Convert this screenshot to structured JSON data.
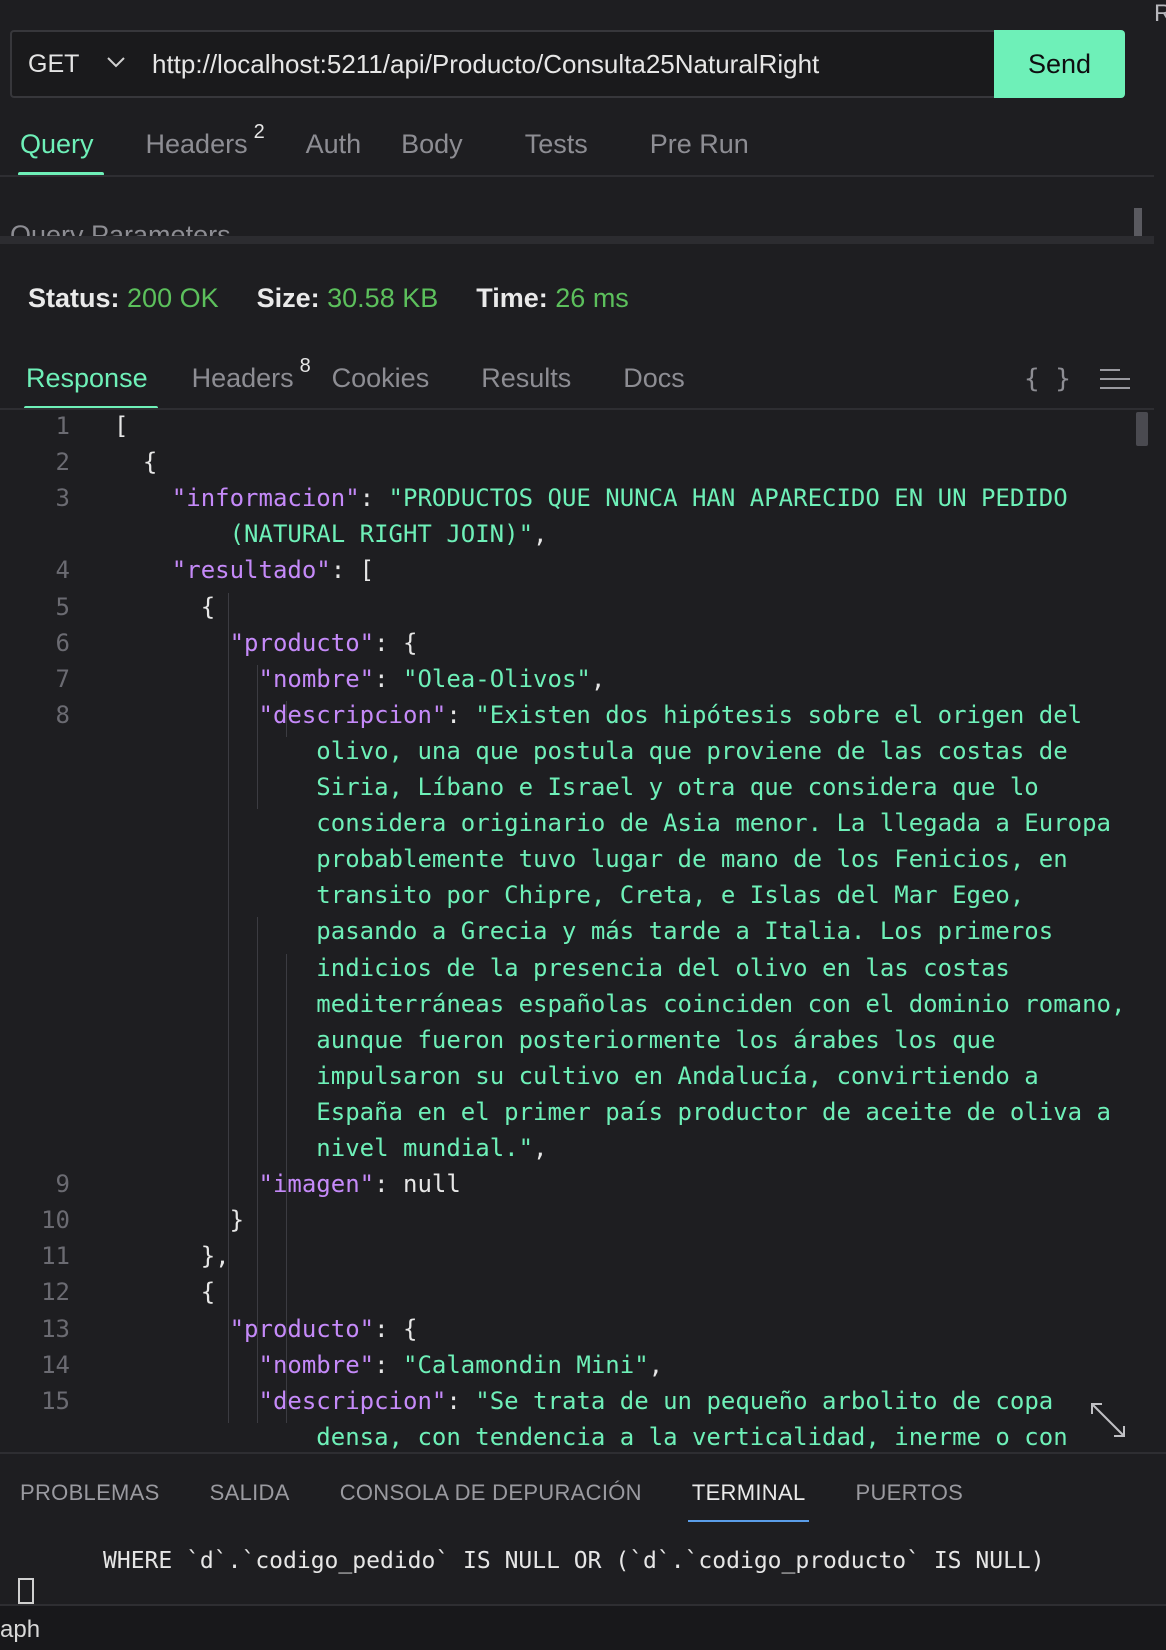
{
  "request": {
    "method": "GET",
    "url": "http://localhost:5211/api/Producto/Consulta25NaturalRight",
    "send_label": "Send"
  },
  "request_tabs": [
    {
      "label": "Query",
      "active": true,
      "badge": ""
    },
    {
      "label": "Headers",
      "active": false,
      "badge": "2"
    },
    {
      "label": "Auth",
      "active": false,
      "badge": ""
    },
    {
      "label": "Body",
      "active": false,
      "badge": ""
    },
    {
      "label": "Tests",
      "active": false,
      "badge": ""
    },
    {
      "label": "Pre Run",
      "active": false,
      "badge": ""
    }
  ],
  "query_params_heading": "Query Parameters",
  "status": {
    "status_label": "Status:",
    "status_value": "200 OK",
    "size_label": "Size:",
    "size_value": "30.58 KB",
    "time_label": "Time:",
    "time_value": "26 ms"
  },
  "response_tabs": [
    {
      "label": "Response",
      "active": true,
      "badge": ""
    },
    {
      "label": "Headers",
      "active": false,
      "badge": "8"
    },
    {
      "label": "Cookies",
      "active": false,
      "badge": ""
    },
    {
      "label": "Results",
      "active": false,
      "badge": ""
    },
    {
      "label": "Docs",
      "active": false,
      "badge": ""
    }
  ],
  "icons": {
    "format": "braces-icon",
    "wrap": "wrap-lines-icon",
    "expand": "expand-icon",
    "method_dropdown": "chevron-down-icon"
  },
  "code_lines": [
    {
      "n": "1",
      "indent": 0,
      "parts": [
        [
          "p",
          "["
        ]
      ]
    },
    {
      "n": "2",
      "indent": 1,
      "parts": [
        [
          "p",
          "{"
        ]
      ]
    },
    {
      "n": "3",
      "indent": 2,
      "parts": [
        [
          "k",
          "\"informacion\""
        ],
        [
          "p",
          ": "
        ],
        [
          "s",
          "\"PRODUCTOS QUE NUNCA HAN APARECIDO EN UN PEDIDO"
        ]
      ]
    },
    {
      "n": "",
      "indent": 4,
      "parts": [
        [
          "s",
          "(NATURAL RIGHT JOIN)\""
        ],
        [
          "p",
          ","
        ]
      ]
    },
    {
      "n": "4",
      "indent": 2,
      "parts": [
        [
          "k",
          "\"resultado\""
        ],
        [
          "p",
          ": ["
        ]
      ]
    },
    {
      "n": "5",
      "indent": 3,
      "parts": [
        [
          "p",
          "{"
        ]
      ]
    },
    {
      "n": "6",
      "indent": 4,
      "parts": [
        [
          "k",
          "\"producto\""
        ],
        [
          "p",
          ": {"
        ]
      ]
    },
    {
      "n": "7",
      "indent": 5,
      "parts": [
        [
          "k",
          "\"nombre\""
        ],
        [
          "p",
          ": "
        ],
        [
          "s",
          "\"Olea-Olivos\""
        ],
        [
          "p",
          ","
        ]
      ]
    },
    {
      "n": "8",
      "indent": 5,
      "parts": [
        [
          "k",
          "\"descripcion\""
        ],
        [
          "p",
          ": "
        ],
        [
          "s",
          "\"Existen dos hipótesis sobre el origen del"
        ]
      ]
    },
    {
      "n": "",
      "indent": 7,
      "parts": [
        [
          "s",
          "olivo, una que postula que proviene de las costas de"
        ]
      ]
    },
    {
      "n": "",
      "indent": 7,
      "parts": [
        [
          "s",
          "Siria, Líbano e Israel y otra que considera que lo"
        ]
      ]
    },
    {
      "n": "",
      "indent": 7,
      "parts": [
        [
          "s",
          "considera originario de Asia menor. La llegada a Europa"
        ]
      ]
    },
    {
      "n": "",
      "indent": 7,
      "parts": [
        [
          "s",
          "probablemente tuvo lugar de mano de los Fenicios, en"
        ]
      ]
    },
    {
      "n": "",
      "indent": 7,
      "parts": [
        [
          "s",
          "transito por Chipre, Creta, e Islas del Mar Egeo,"
        ]
      ]
    },
    {
      "n": "",
      "indent": 7,
      "parts": [
        [
          "s",
          "pasando a Grecia y más tarde a Italia. Los primeros"
        ]
      ]
    },
    {
      "n": "",
      "indent": 7,
      "parts": [
        [
          "s",
          "indicios de la presencia del olivo en las costas"
        ]
      ]
    },
    {
      "n": "",
      "indent": 7,
      "parts": [
        [
          "s",
          "mediterráneas españolas coinciden con el dominio romano,"
        ]
      ]
    },
    {
      "n": "",
      "indent": 7,
      "parts": [
        [
          "s",
          "aunque fueron posteriormente los árabes los que"
        ]
      ]
    },
    {
      "n": "",
      "indent": 7,
      "parts": [
        [
          "s",
          "impulsaron su cultivo en Andalucía, convirtiendo a"
        ]
      ]
    },
    {
      "n": "",
      "indent": 7,
      "parts": [
        [
          "s",
          "España en el primer país productor de aceite de oliva a"
        ]
      ]
    },
    {
      "n": "",
      "indent": 7,
      "parts": [
        [
          "s",
          "nivel mundial.\""
        ],
        [
          "p",
          ","
        ]
      ]
    },
    {
      "n": "9",
      "indent": 5,
      "parts": [
        [
          "k",
          "\"imagen\""
        ],
        [
          "p",
          ": null"
        ]
      ]
    },
    {
      "n": "10",
      "indent": 4,
      "parts": [
        [
          "p",
          "}"
        ]
      ]
    },
    {
      "n": "11",
      "indent": 3,
      "parts": [
        [
          "p",
          "},"
        ]
      ]
    },
    {
      "n": "12",
      "indent": 3,
      "parts": [
        [
          "p",
          "{"
        ]
      ]
    },
    {
      "n": "13",
      "indent": 4,
      "parts": [
        [
          "k",
          "\"producto\""
        ],
        [
          "p",
          ": {"
        ]
      ]
    },
    {
      "n": "14",
      "indent": 5,
      "parts": [
        [
          "k",
          "\"nombre\""
        ],
        [
          "p",
          ": "
        ],
        [
          "s",
          "\"Calamondin Mini\""
        ],
        [
          "p",
          ","
        ]
      ]
    },
    {
      "n": "15",
      "indent": 5,
      "parts": [
        [
          "k",
          "\"descripcion\""
        ],
        [
          "p",
          ": "
        ],
        [
          "s",
          "\"Se trata de un pequeño arbolito de copa"
        ]
      ]
    },
    {
      "n": "",
      "indent": 7,
      "parts": [
        [
          "s",
          "densa, con tendencia a la verticalidad, inerme o con"
        ]
      ]
    }
  ],
  "panel_tabs": [
    {
      "label": "PROBLEMAS",
      "active": false
    },
    {
      "label": "SALIDA",
      "active": false
    },
    {
      "label": "CONSOLA DE DEPURACIÓN",
      "active": false
    },
    {
      "label": "TERMINAL",
      "active": true
    },
    {
      "label": "PUERTOS",
      "active": false
    }
  ],
  "terminal_line": "WHERE `d`.`codigo_pedido` IS NULL OR (`d`.`codigo_producto` IS NULL)",
  "statusbar_text": "aph",
  "corner_text": "R",
  "colors": {
    "accent": "#6ef0b8",
    "key": "#c58af9",
    "status_ok": "#5cc05c",
    "background": "#1e1e21"
  }
}
